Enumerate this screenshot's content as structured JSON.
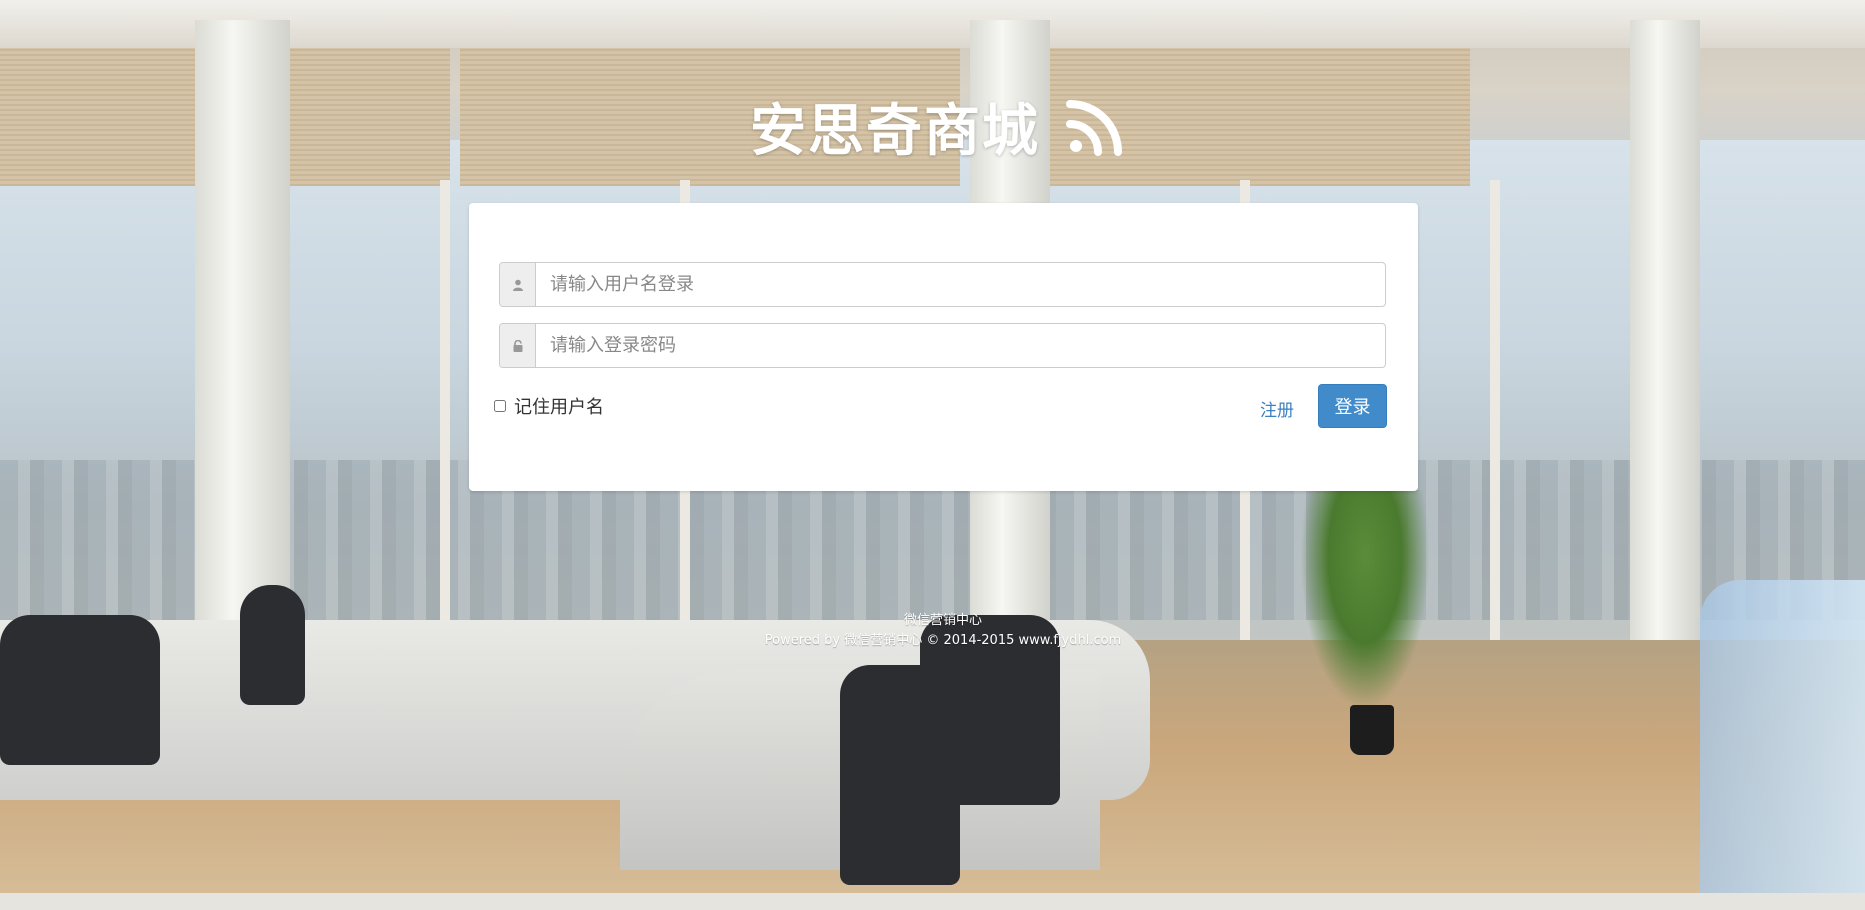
{
  "header": {
    "title": "安思奇商城",
    "icon": "rss-icon"
  },
  "login": {
    "username_placeholder": "请输入用户名登录",
    "password_placeholder": "请输入登录密码",
    "username_value": "",
    "password_value": "",
    "user_icon": "user-icon",
    "lock_icon": "lock-icon",
    "remember_label": "记住用户名",
    "remember_checked": false,
    "register_label": "注册",
    "submit_label": "登录"
  },
  "footer": {
    "line1": "微信营销中心",
    "line2": "Powered by 微信营销中心 © 2014-2015 www.fjydhl.com"
  },
  "colors": {
    "primary": "#428bca",
    "link": "#3b7fc4",
    "panel_bg": "#ffffff"
  }
}
